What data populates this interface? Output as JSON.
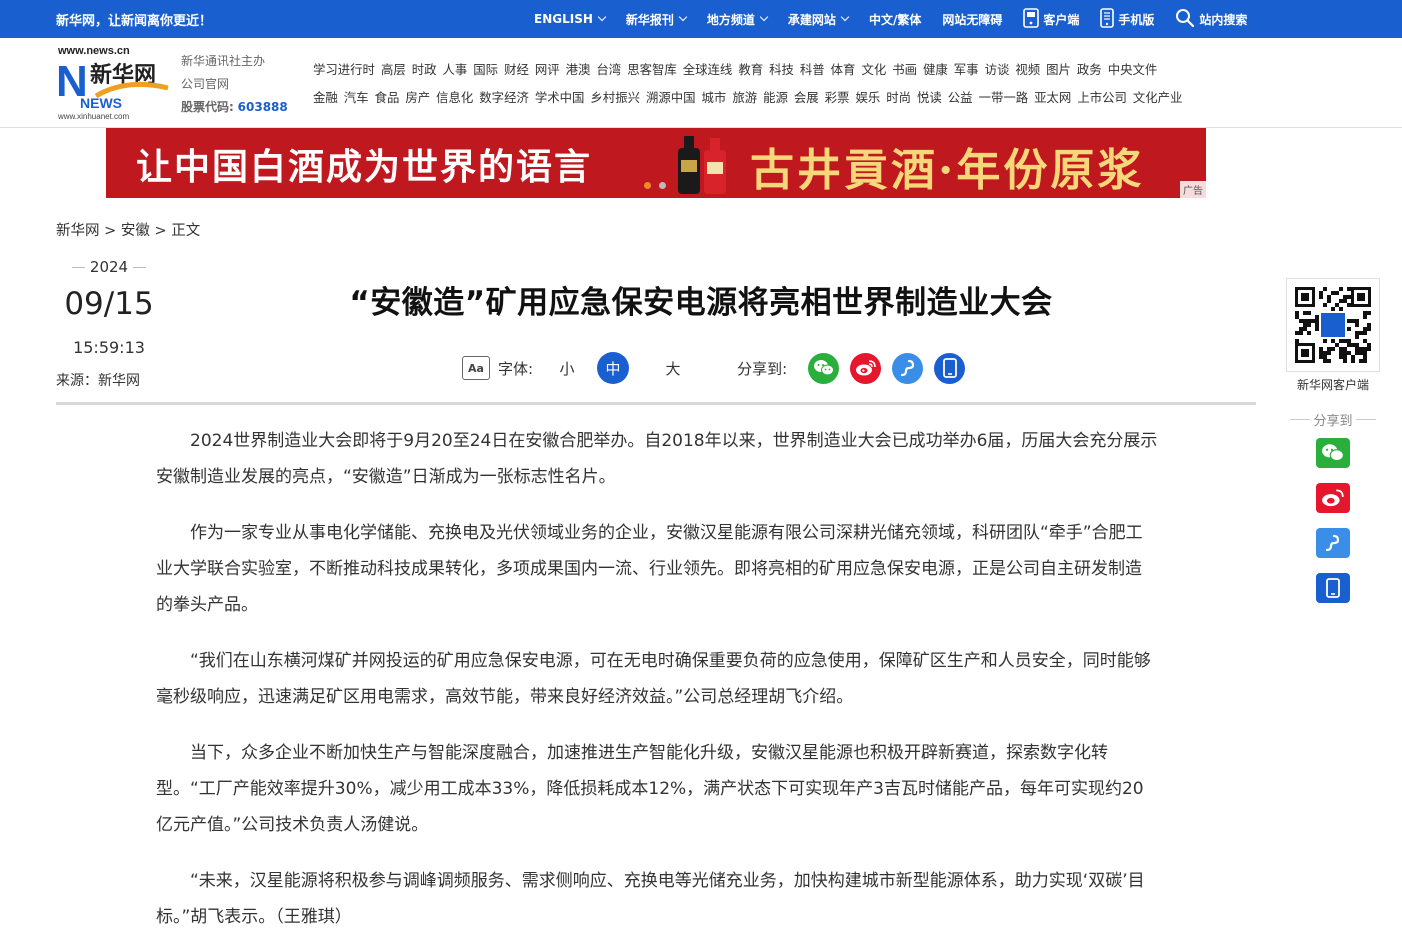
{
  "topbar": {
    "slogan": "新华网，让新闻离你更近！",
    "nav": [
      {
        "label": "ENGLISH",
        "caret": true
      },
      {
        "label": "新华报刊",
        "caret": true
      },
      {
        "label": "地方频道",
        "caret": true
      },
      {
        "label": "承建网站",
        "caret": true
      },
      {
        "label": "中文/繁体",
        "caret": false
      },
      {
        "label": "网站无障碍",
        "caret": false
      },
      {
        "label": "客户端",
        "icon": "app-icon"
      },
      {
        "label": "手机版",
        "icon": "mobile-icon"
      },
      {
        "label": "站内搜索",
        "icon": "search-icon"
      }
    ]
  },
  "header": {
    "logo_text": "新华网",
    "logo_url_text": "www.news.cn",
    "logo_sub": "www.xinhuanet.com",
    "logo_news": "NEWS",
    "org_line1": "新华通讯社主办",
    "org_line2": "公司官网",
    "stock_label": "股票代码:",
    "stock_code": "603888",
    "nav_row1": [
      "学习进行时",
      "高层",
      "时政",
      "人事",
      "国际",
      "财经",
      "网评",
      "港澳",
      "台湾",
      "思客智库",
      "全球连线",
      "教育",
      "科技",
      "科普",
      "体育",
      "文化",
      "书画",
      "健康",
      "军事",
      "访谈",
      "视频",
      "图片",
      "政务",
      "中央文件"
    ],
    "nav_row2": [
      "金融",
      "汽车",
      "食品",
      "房产",
      "信息化",
      "数字经济",
      "学术中国",
      "乡村振兴",
      "溯源中国",
      "城市",
      "旅游",
      "能源",
      "会展",
      "彩票",
      "娱乐",
      "时尚",
      "悦读",
      "公益",
      "一带一路",
      "亚太网",
      "上市公司",
      "文化产业"
    ]
  },
  "banner": {
    "text_left": "让中国白酒成为世界的语言",
    "text_right": "古井貢酒·年份原浆",
    "reg_mark": "®",
    "ad_tag": "广告"
  },
  "breadcrumb": [
    "新华网",
    ">",
    "安徽",
    ">",
    "正文"
  ],
  "meta": {
    "year": "2024",
    "date": "09/15",
    "time": "15:59:13",
    "source": "来源：新华网"
  },
  "article": {
    "title": "“安徽造”矿用应急保安电源将亮相世界制造业大会",
    "tools": {
      "font_label": "字体:",
      "font_icon": "Aa",
      "sizes": [
        "小",
        "中",
        "大"
      ],
      "selected_size": "中",
      "share_label": "分享到:"
    },
    "paragraphs": [
      "2024世界制造业大会即将于9月20至24日在安徽合肥举办。自2018年以来，世界制造业大会已成功举办6届，历届大会充分展示安徽制造业发展的亮点，“安徽造”日渐成为一张标志性名片。",
      "作为一家专业从事电化学储能、充换电及光伏领域业务的企业，安徽汉星能源有限公司深耕光储充领域，科研团队“牵手”合肥工业大学联合实验室，不断推动科技成果转化，多项成果国内一流、行业领先。即将亮相的矿用应急保安电源，正是公司自主研发制造的拳头产品。",
      "“我们在山东横河煤矿并网投运的矿用应急保安电源，可在无电时确保重要负荷的应急使用，保障矿区生产和人员安全，同时能够毫秒级响应，迅速满足矿区用电需求，高效节能，带来良好经济效益。”公司总经理胡飞介绍。",
      "当下，众多企业不断加快生产与智能深度融合，加速推进生产智能化升级，安徽汉星能源也积极开辟新赛道，探索数字化转型。“工厂产能效率提升30%，减少用工成本33%，降低损耗成本12%，满产状态下可实现年产3吉瓦时储能产品，每年可实现约20亿元产值。”公司技术负责人汤健说。",
      "“未来，汉星能源将积极参与调峰调频服务、需求侧响应、充换电等光储充业务，加快构建城市新型能源体系，助力实现‘双碳’目标。”胡飞表示。（王雅琪）"
    ]
  },
  "rail": {
    "qr_label": "新华网客户端",
    "share_label": "分享到"
  },
  "colors": {
    "brand_blue": "#1a5fd0",
    "wechat_green": "#2aae3c",
    "weibo_red": "#e6162d",
    "link_blue": "#3b8ee8",
    "mobile_blue": "#1a5fd0"
  }
}
